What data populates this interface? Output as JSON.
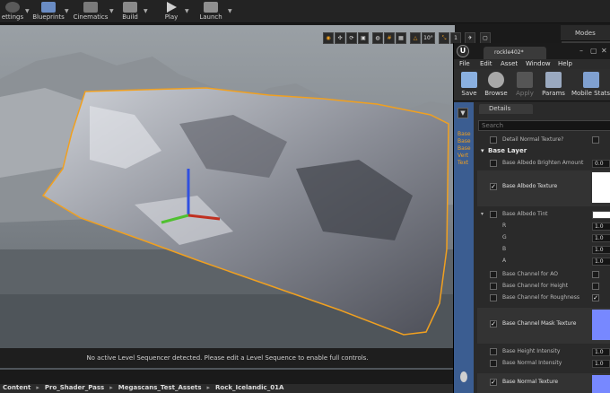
{
  "toolbar": {
    "items": [
      {
        "label": "ettings",
        "icon": "gear-icon"
      },
      {
        "label": "Blueprints",
        "icon": "blueprint-icon"
      },
      {
        "label": "Cinematics",
        "icon": "clapper-icon"
      },
      {
        "label": "Build",
        "icon": "build-icon"
      },
      {
        "label": "Play",
        "icon": "play-icon"
      },
      {
        "label": "Launch",
        "icon": "launch-icon"
      }
    ]
  },
  "viewport": {
    "tools": [
      "10°",
      "1"
    ],
    "message": "No active Level Sequencer detected. Please edit a Level Sequence to enable full controls."
  },
  "content_bar": {
    "crumbs": [
      "Content",
      "Pro_Shader_Pass",
      "Megascans_Test_Assets",
      "Rock_Icelandic_01A"
    ]
  },
  "modes_tab": "Modes",
  "material_editor": {
    "tab_title": "rockle402*",
    "logo": "U",
    "menu": [
      "File",
      "Edit",
      "Asset",
      "Window",
      "Help"
    ],
    "tools": [
      {
        "label": "Save",
        "icon": "save-icon"
      },
      {
        "label": "Browse",
        "icon": "browse-icon"
      },
      {
        "label": "Apply",
        "icon": "apply-icon",
        "disabled": true
      },
      {
        "label": "Params",
        "icon": "params-icon"
      },
      {
        "label": "Mobile Stats",
        "icon": "mobile-stats-icon"
      }
    ],
    "graph_labels": [
      "Base",
      "Base",
      "Base",
      "Vert",
      "Text"
    ],
    "details": {
      "tab_label": "Details",
      "search_placeholder": "Search",
      "rows": {
        "detail_normal": "Detail Normal Texture?",
        "section": "Base Layer",
        "brighten": "Base Albedo Brighten Amount",
        "brighten_val": "0.0",
        "albedo_tex": "Base Albedo Texture",
        "albedo_tint": "Base Albedo Tint",
        "r": "R",
        "g": "G",
        "b": "B",
        "a": "A",
        "one": "1.0",
        "ao": "Base Channel for AO",
        "height": "Base Channel for Height",
        "roughness": "Base Channel for Roughness",
        "mask": "Base Channel Mask Texture",
        "height_intensity": "Base Height Intensity",
        "normal_intensity": "Base Normal Intensity",
        "normal_tex": "Base Normal Texture"
      }
    }
  }
}
